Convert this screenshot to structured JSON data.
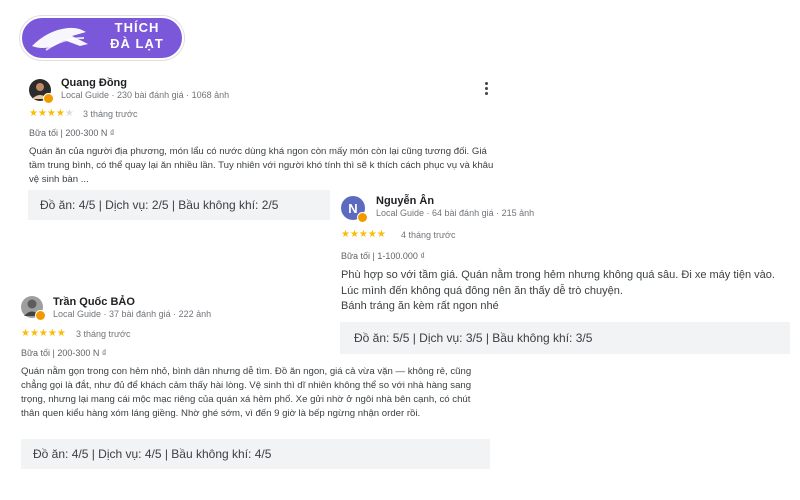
{
  "logo": {
    "line1": "THÍCH",
    "line2": "ĐÀ LẠT"
  },
  "colors": {
    "brand": "#7b57d9",
    "star": "#fbbc04",
    "guide_badge": "#f29900",
    "rating_bg": "#f1f3f4"
  },
  "reviews": [
    {
      "name": "Quang Đồng",
      "meta": "Local Guide · 230 bài đánh giá · 1068 ảnh",
      "stars": 4,
      "ago": "3 tháng trước",
      "meal": "Bữa tối  |  200-300 N ₫",
      "text": "Quán ăn của người địa phương, món lẩu có nước dùng khá ngon còn mấy món còn lại cũng tương đối. Giá tầm trung bình, có thể quay lại ăn nhiều lần. Tuy nhiên với người khó tính thì sẽ k thích cách phục vụ và khâu vệ sinh bàn ...",
      "ratings": "Đồ ăn: 4/5  |  Dịch vụ: 2/5  |  Bầu không khí: 2/5"
    },
    {
      "name": "Nguyễn Ân",
      "initial": "N",
      "meta": "Local Guide · 64 bài đánh giá · 215 ảnh",
      "stars": 5,
      "ago": "4 tháng trước",
      "meal": "Bữa tối  |  1-100.000 ₫",
      "text_lines": [
        "Phù hợp so với tầm giá. Quán nằm trong hẻm nhưng không quá sâu. Đi xe máy tiện vào.",
        "Lúc mình đến không quá đông nên ăn thấy dễ trò chuyện.",
        "Bánh tráng ăn kèm rất ngon nhé"
      ],
      "ratings": "Đồ ăn: 5/5  |  Dịch vụ: 3/5  |  Bầu không khí: 3/5"
    },
    {
      "name": "Trần Quốc BẢO",
      "meta": "Local Guide · 37 bài đánh giá · 222 ảnh",
      "stars": 5,
      "ago": "3 tháng trước",
      "meal": "Bữa tối  |  200-300 N ₫",
      "text": "Quán nằm gọn trong con hẻm nhỏ, bình dân nhưng dễ tìm. Đồ ăn ngon, giá cả vừa vặn — không rẻ, cũng chẳng gọi là đắt, như đủ để khách cảm thấy hài lòng. Vệ sinh thì dĩ nhiên không thể so với nhà hàng sang trọng, nhưng lại mang cái mộc mạc riêng của quán xá hẻm phố. Xe gửi nhờ ở ngôi nhà bên cạnh, có chút thân quen kiểu hàng xóm láng giềng. Nhờ ghé sớm, vì đến 9 giờ là bếp ngừng nhận order rồi.",
      "ratings": "Đồ ăn: 4/5  |  Dịch vụ: 4/5  |  Bầu không khí: 4/5"
    }
  ]
}
